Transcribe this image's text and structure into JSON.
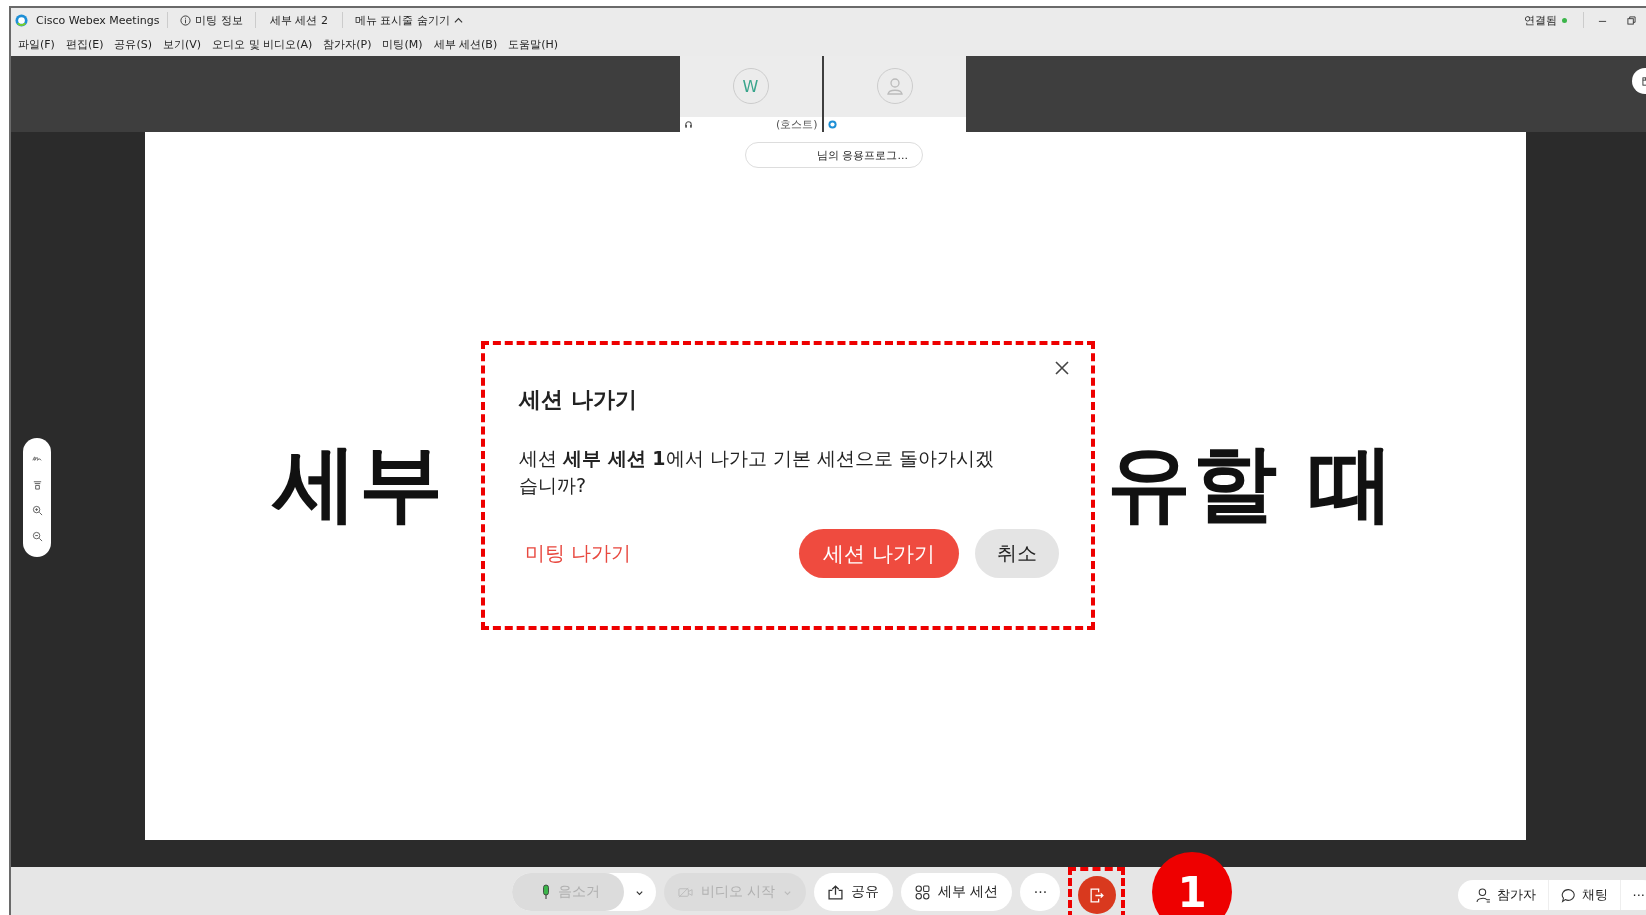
{
  "window": {
    "app_title": "Cisco Webex Meetings",
    "meeting_info": "미팅 정보",
    "session_name": "세부 세션 2",
    "hide_menu": "메뉴 표시줄 숨기기",
    "status": "연결됨",
    "connected": true
  },
  "menu": [
    "파일(F)",
    "편집(E)",
    "공유(S)",
    "보기(V)",
    "오디오 및 비디오(A)",
    "참가자(P)",
    "미팅(M)",
    "세부 세션(B)",
    "도움말(H)"
  ],
  "participants": [
    {
      "kind": "initial",
      "avatar": "W",
      "label": "(호스트)"
    },
    {
      "kind": "generic"
    }
  ],
  "share_banner": "님의 응용프로그...",
  "slide": {
    "text_left": "세부",
    "text_right": "유할 때"
  },
  "dialog": {
    "title": "세션 나가기",
    "message": "세션 **세부 세션 1**에서 나가고 기본 세션으로 돌아가시겠습니까?",
    "leave_meeting": "미팅 나가기",
    "confirm": "세션 나가기",
    "cancel": "취소"
  },
  "toolbar": [
    {
      "kind": "mute",
      "label": "음소거",
      "disabled": true
    },
    {
      "kind": "video",
      "label": "비디오 시작",
      "disabled": true
    },
    {
      "kind": "share",
      "label": "공유",
      "disabled": false
    },
    {
      "kind": "breakout",
      "label": "세부 세션",
      "disabled": false
    },
    {
      "kind": "more",
      "label": "···",
      "disabled": false
    },
    {
      "kind": "leave",
      "disabled": false
    }
  ],
  "right_toolbar": [
    {
      "kind": "participants",
      "label": "참가자"
    },
    {
      "kind": "chat",
      "label": "채팅"
    },
    {
      "kind": "more",
      "label": "···"
    }
  ],
  "annotation": {
    "step": "1"
  }
}
